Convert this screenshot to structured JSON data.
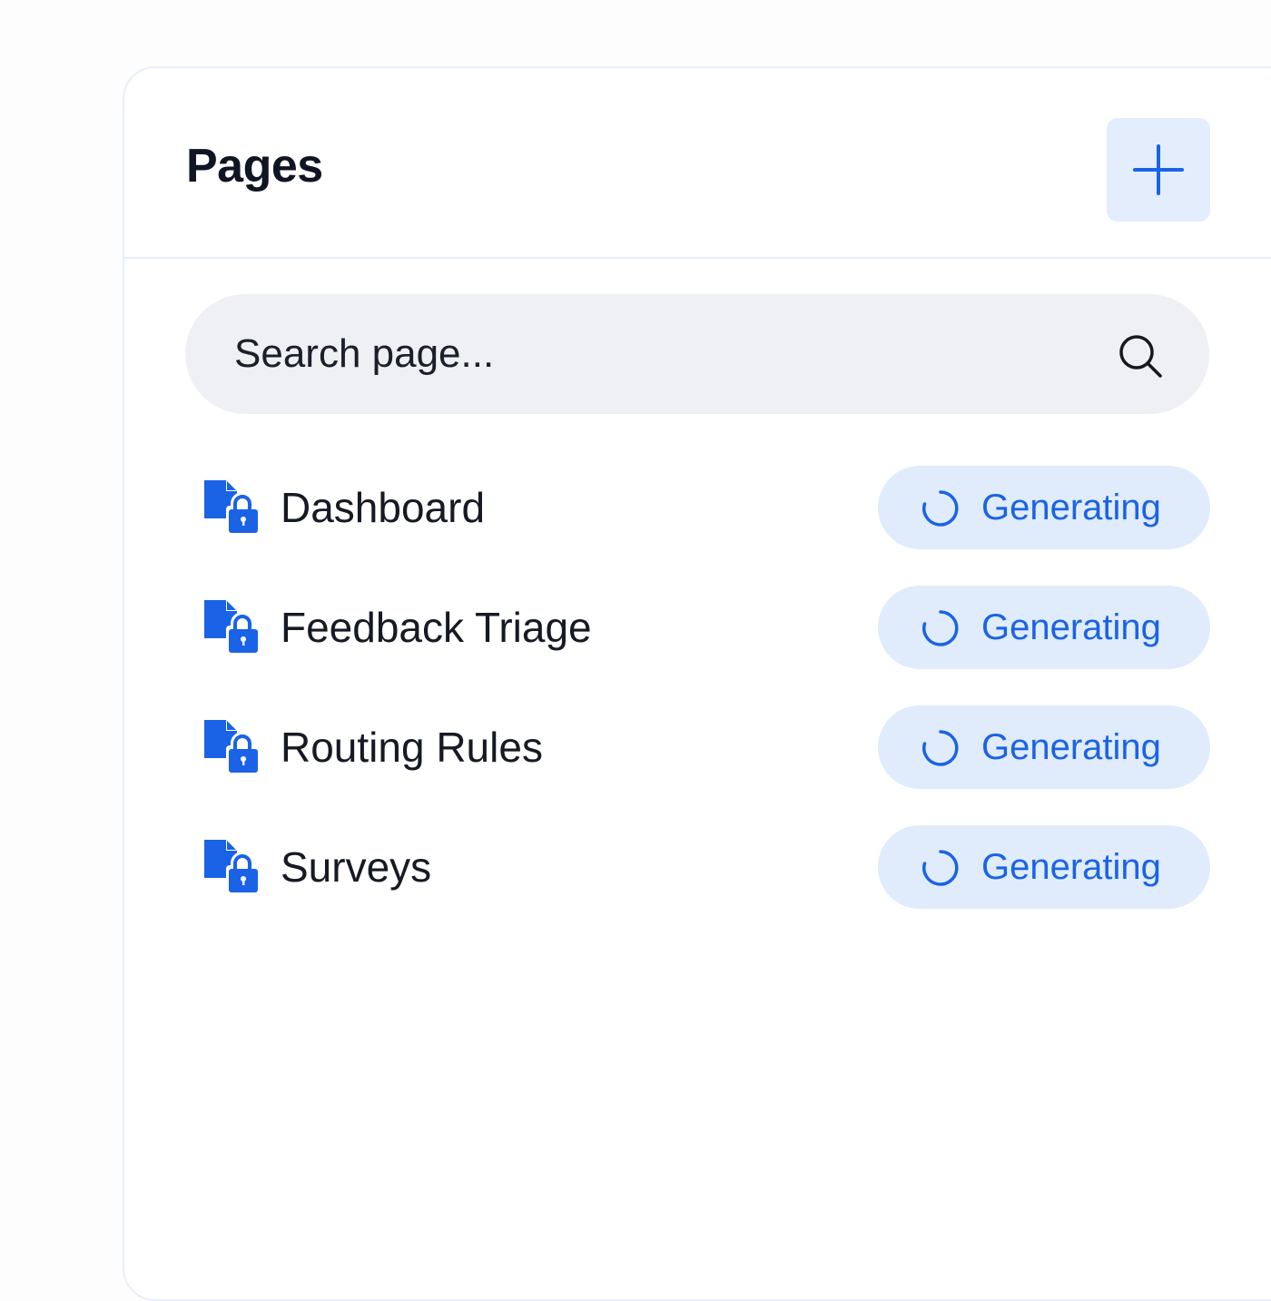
{
  "header": {
    "title": "Pages",
    "add_icon": "plus-icon"
  },
  "search": {
    "placeholder": "Search page...",
    "icon": "search-icon"
  },
  "colors": {
    "accent": "#1a63e6",
    "accent_soft": "#e0ecfc",
    "text": "#161a24"
  },
  "pages": [
    {
      "label": "Dashboard",
      "icon": "locked-document-icon",
      "status": "Generating",
      "status_icon": "spinner-icon"
    },
    {
      "label": "Feedback Triage",
      "icon": "locked-document-icon",
      "status": "Generating",
      "status_icon": "spinner-icon"
    },
    {
      "label": "Routing Rules",
      "icon": "locked-document-icon",
      "status": "Generating",
      "status_icon": "spinner-icon"
    },
    {
      "label": "Surveys",
      "icon": "locked-document-icon",
      "status": "Generating",
      "status_icon": "spinner-icon"
    }
  ]
}
